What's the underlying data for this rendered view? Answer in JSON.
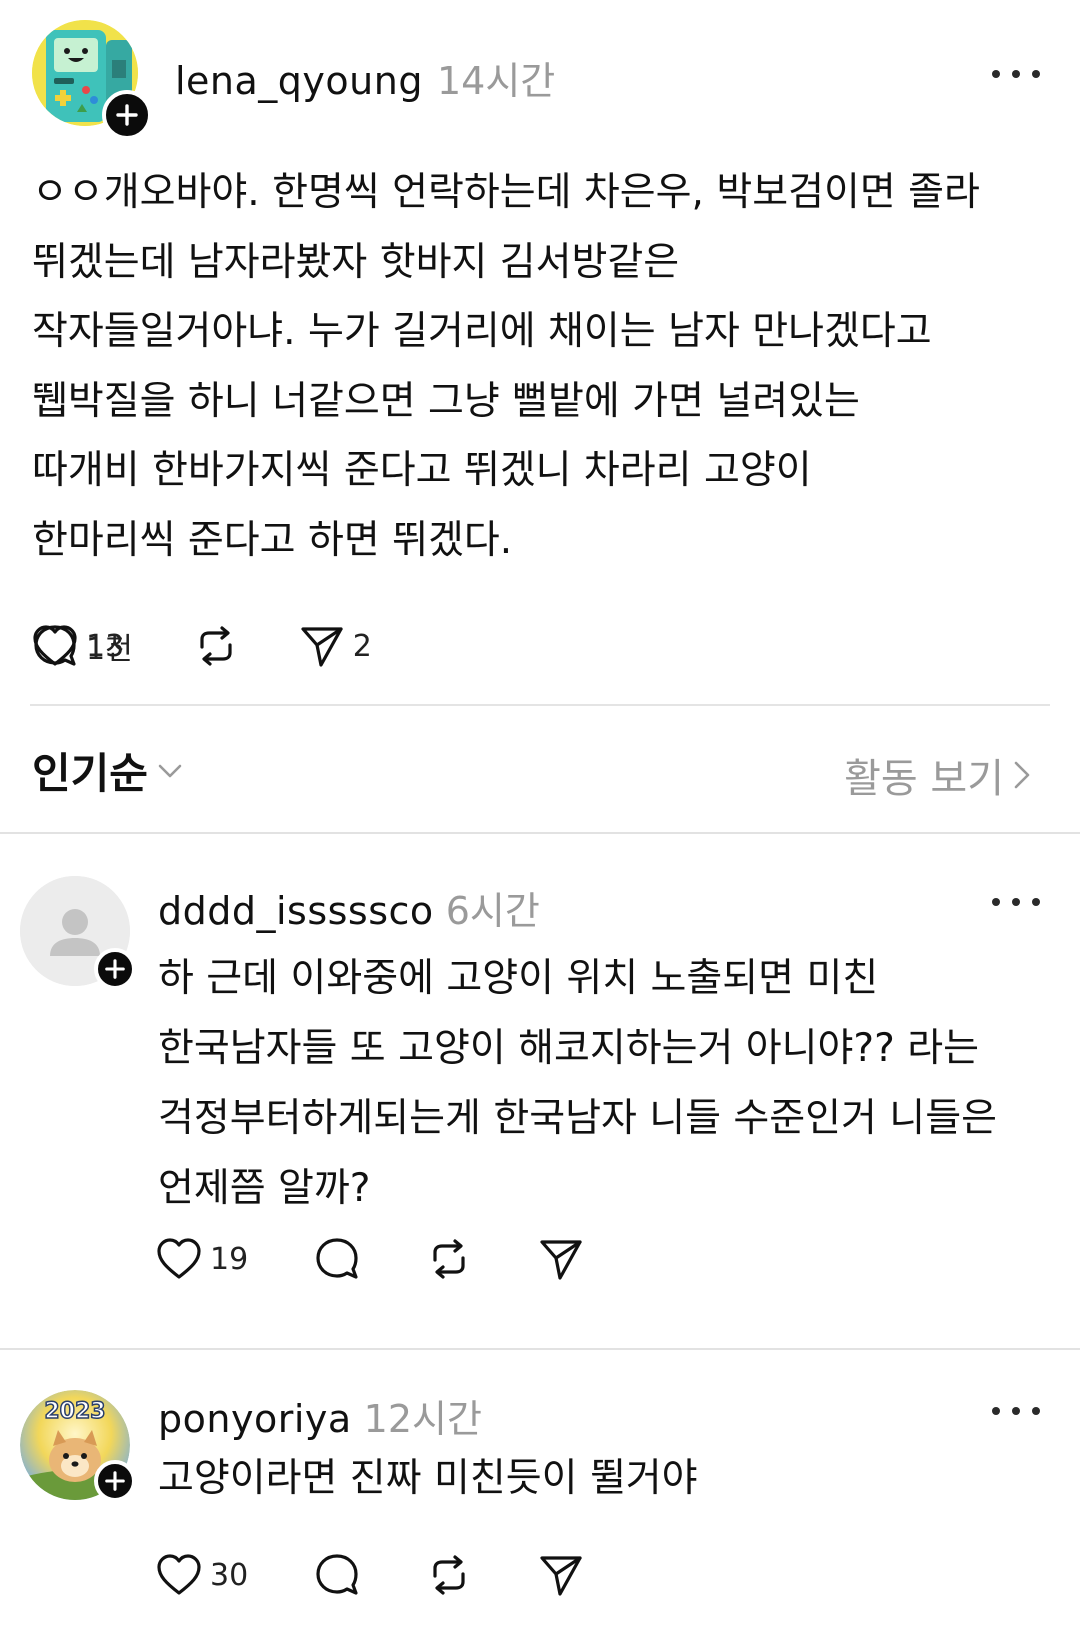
{
  "main_post": {
    "username": "lena_qyoung",
    "time": "14시간",
    "body": "ㅇㅇ개오바야. 한명씩 언락하는데 차은우, 박보검이면 졸라\n뛰겠는데 남자라봤자 핫바지 김서방같은\n작자들일거아냐. 누가 길거리에 채이는 남자 만나겠다고\n뛥박질을 하니 너같으면 그냥 뻘밭에 가면 널려있는\n따개비 한바가지씩 준다고 뛰겠니 차라리 고양이\n한마리씩 준다고 하면 뛰겠다.",
    "likes": "1천",
    "comments": "13",
    "shares": "2"
  },
  "sort_bar": {
    "sort_label": "인기순",
    "activity_label": "활동 보기"
  },
  "comments": [
    {
      "username": "dddd_isssssco",
      "time": "6시간",
      "body": "하 근데 이와중에 고양이 위치 노출되면 미친\n한국남자들 또 고양이 해코지하는거 아니야?? 라는\n걱정부터하게되는게 한국남자 니들 수준인거 니들은\n언제쯤 알까?",
      "likes": "19"
    },
    {
      "username": "ponyoriya",
      "time": "12시간",
      "avatar_text": "2023",
      "body": "고양이라면 진짜 미친듯이 뛸거야",
      "likes": "30"
    }
  ],
  "icons": {
    "like": "heart-icon",
    "comment": "speech-bubble-icon",
    "repost": "repost-icon",
    "share": "paper-plane-icon",
    "more": "more-dots-icon",
    "follow": "plus-icon",
    "sort_chevron": "chevron-down-icon",
    "activity_chevron": "chevron-right-icon"
  },
  "colors": {
    "text": "#111111",
    "muted": "#9a9a9a",
    "divider": "#e4e4e4",
    "badge": "#0b0b0b"
  }
}
